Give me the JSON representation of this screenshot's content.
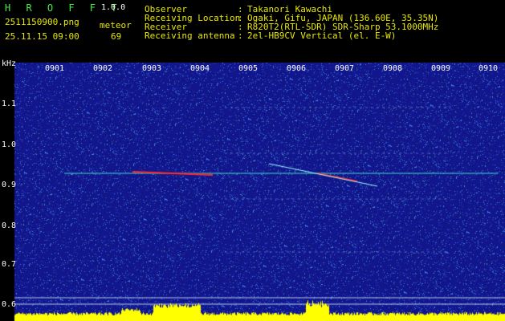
{
  "app": {
    "name": "H R O F F T",
    "version": "1.0.0"
  },
  "file": {
    "name": "2511150900.png",
    "datetime": "25.11.15 09:00"
  },
  "counter": {
    "label": "meteor",
    "value": "69"
  },
  "info": [
    {
      "key": "Observer",
      "sep": ":",
      "value": "Takanori Kawachi"
    },
    {
      "key": "Receiving Location",
      "sep": ":",
      "value": "Ogaki, Gifu, JAPAN (136.60E, 35.35N)"
    },
    {
      "key": "Receiver",
      "sep": ":",
      "value": "R820T2(RTL-SDR) SDR-Sharp 53.1000MHz"
    },
    {
      "key": "Receiving antenna",
      "sep": ":",
      "value": "2el-HB9CV Vertical (el. E-W)"
    }
  ],
  "yaxis": {
    "unit": "kHz",
    "ticks": [
      "1.1",
      "1.0",
      "0.9",
      "0.8",
      "0.7",
      "0.6"
    ]
  },
  "xaxis": {
    "ticks": [
      "0901",
      "0902",
      "0903",
      "0904",
      "0905",
      "0906",
      "0907",
      "0908",
      "0909",
      "0910"
    ]
  },
  "colors": {
    "background": "#1a1a8c",
    "carrier": "#40e0d0",
    "echo": "#ff2a2a",
    "noise_floor": "#ffff00"
  }
}
